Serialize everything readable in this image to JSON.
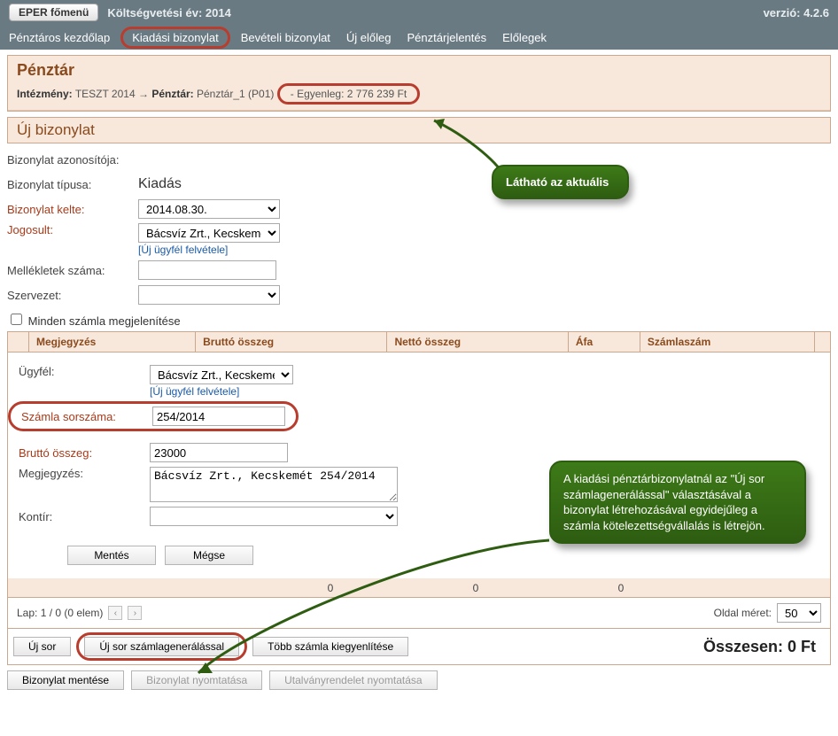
{
  "topbar": {
    "home_btn": "EPER főmenü",
    "year_label": "Költségvetési év: 2014",
    "version": "verzió: 4.2.6"
  },
  "menu": {
    "items": [
      "Pénztáros kezdőlap",
      "Kiadási bizonylat",
      "Bevételi bizonylat",
      "Új előleg",
      "Pénztárjelentés",
      "Előlegek"
    ]
  },
  "header_panel": {
    "title": "Pénztár",
    "inst_label": "Intézmény:",
    "inst_value": "TESZT 2014",
    "arrow": "→",
    "penz_label": "Pénztár:",
    "penz_value": "Pénztár_1 (P01)",
    "balance_label": "- Egyenleg:",
    "balance_value": "2 776 239 Ft"
  },
  "section_title": "Új bizonylat",
  "form": {
    "id_label": "Bizonylat azonosítója:",
    "type_label": "Bizonylat típusa:",
    "type_value": "Kiadás",
    "date_label": "Bizonylat kelte:",
    "date_value": "2014.08.30.",
    "jogosult_label": "Jogosult:",
    "jogosult_value": "Bácsvíz Zrt., Kecskemét",
    "new_ugyfel": "[Új ügyfél felvétele]",
    "mellek_label": "Mellékletek száma:",
    "szerv_label": "Szervezet:",
    "show_all": "Minden számla megjelenítése"
  },
  "table": {
    "cols": [
      "Megjegyzés",
      "Bruttó összeg",
      "Nettó összeg",
      "Áfa",
      "Számlaszám"
    ]
  },
  "detail": {
    "ugyfel_label": "Ügyfél:",
    "ugyfel_value": "Bácsvíz Zrt., Kecskemét",
    "new_ugyfel": "[Új ügyfél felvétele]",
    "sorszam_label": "Számla sorszáma:",
    "sorszam_value": "254/2014",
    "brutto_label": "Bruttó összeg:",
    "brutto_value": "23000",
    "megj_label": "Megjegyzés:",
    "megj_value": "Bácsvíz Zrt., Kecskemét 254/2014",
    "kontir_label": "Kontír:",
    "save_btn": "Mentés",
    "cancel_btn": "Mégse"
  },
  "totals": {
    "brutto": "0",
    "netto": "0",
    "afa": "0"
  },
  "paging": {
    "label": "Lap: 1 / 0 (0 elem)",
    "size_label": "Oldal méret:",
    "size_value": "50"
  },
  "footer": {
    "uj_sor": "Új sor",
    "uj_sor_gen": "Új sor számlagenerálással",
    "tobb": "Több számla kiegyenlítése",
    "grand_total": "Összesen: 0 Ft"
  },
  "bottom": {
    "save": "Bizonylat mentése",
    "print": "Bizonylat nyomtatása",
    "utalvany": "Utalványrendelet nyomtatása"
  },
  "callouts": {
    "c1": "Látható az aktuális",
    "c2": "A kiadási pénztárbizonylatnál az \"Új sor számlagenerálással\" választásával a bizonylat létrehozásával egyidejűleg a számla kötelezettségvállalás is létrejön."
  }
}
